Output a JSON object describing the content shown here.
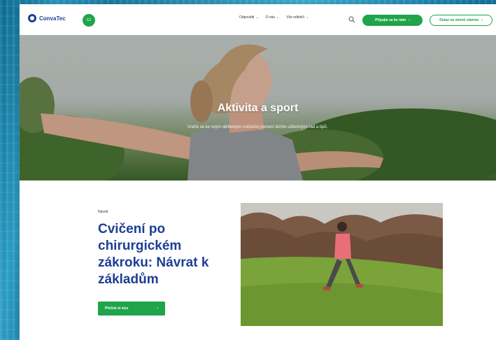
{
  "header": {
    "logo_text": "ConvaTec",
    "country_badge": "CZ",
    "nav": [
      "Odpovědi",
      "O nás",
      "Vše odlehčí"
    ],
    "primary_button": "Připojte se ke nám",
    "secondary_button": "Dotaz na stomii zdarma"
  },
  "hero": {
    "title": "Aktivita a sport",
    "subtitle": "Vraťte se ke svým oblíbeným cvičením pomocí těchto užitečných rad a tipů."
  },
  "article": {
    "eyebrow": "Návod",
    "title": "Cvičení po chirurgickém zákroku: Návrat k základům",
    "cta_label": "Přečíst si více"
  },
  "icons": {
    "search": "search-icon",
    "arrow": "arrow-right-icon",
    "chevron": "chevron-down-icon"
  },
  "colors": {
    "brand_blue": "#1c3f94",
    "brand_green": "#1fa449"
  }
}
